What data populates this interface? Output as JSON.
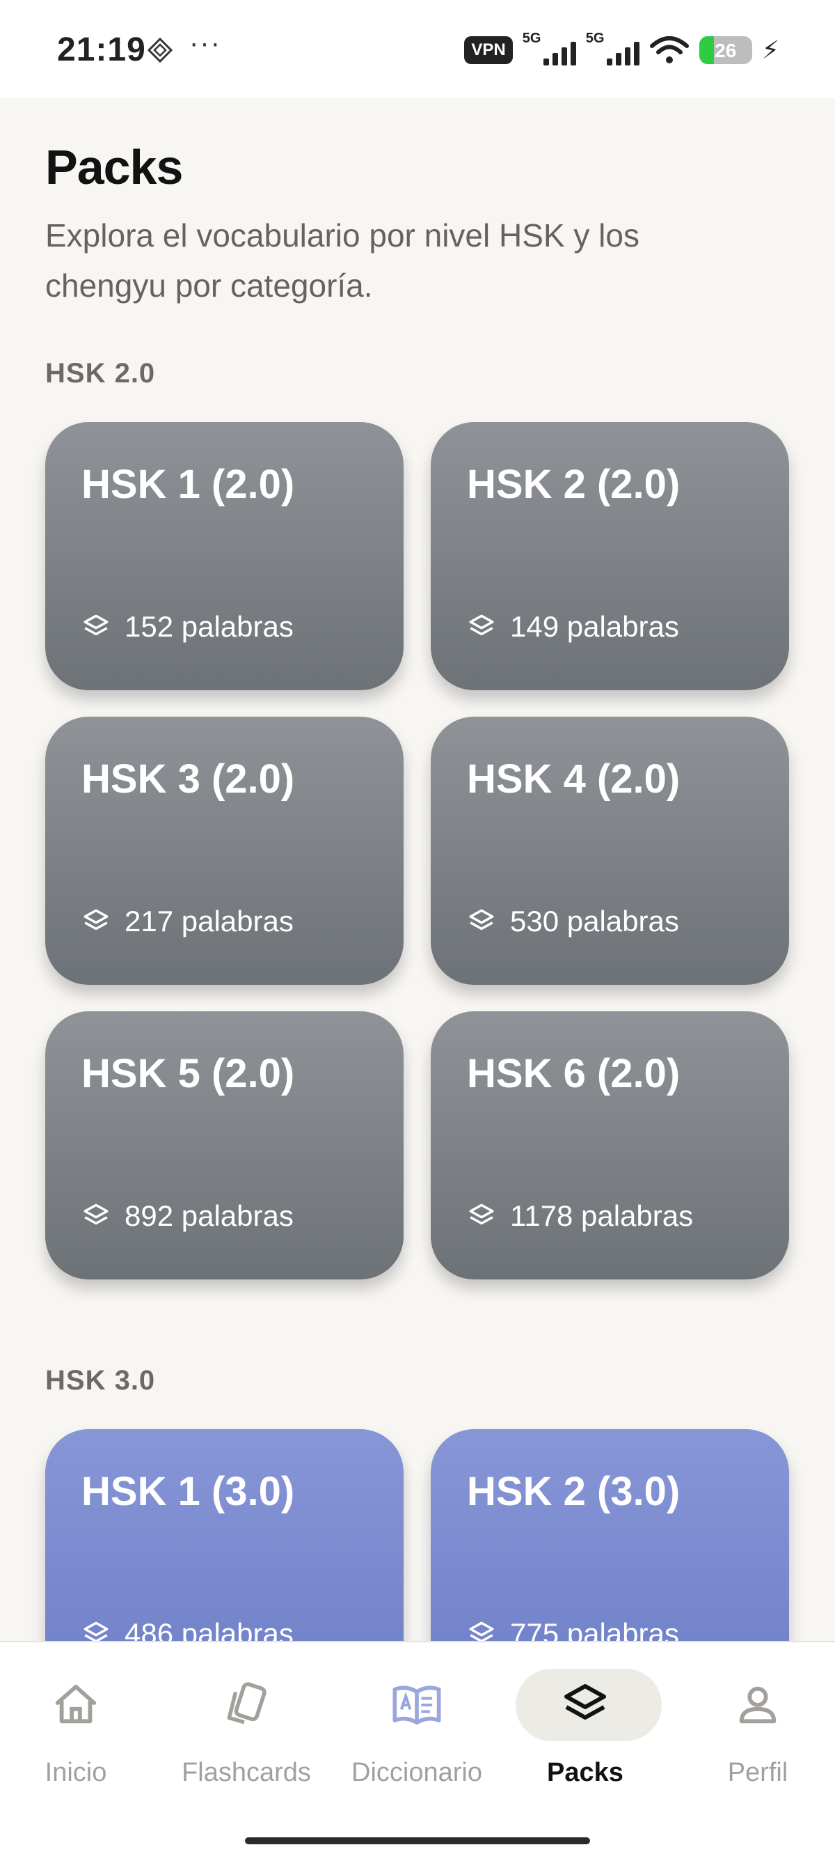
{
  "status_bar": {
    "time": "21:19",
    "vpn": "VPN",
    "network_1": "5G",
    "network_2": "5G",
    "battery": "26",
    "icons": [
      "location-diamond-icon",
      "more-dots-icon",
      "signal-icon",
      "wifi-icon",
      "battery-icon",
      "charging-bolt-icon"
    ]
  },
  "header": {
    "title": "Packs",
    "description": "Explora el vocabulario por nivel HSK y los chengyu por categoría."
  },
  "sections": [
    {
      "label": "HSK 2.0",
      "color": "#7d8186",
      "cards": [
        {
          "title": "HSK 1 (2.0)",
          "count": "152 palabras"
        },
        {
          "title": "HSK 2 (2.0)",
          "count": "149 palabras"
        },
        {
          "title": "HSK 3 (2.0)",
          "count": "217 palabras"
        },
        {
          "title": "HSK 4 (2.0)",
          "count": "530 palabras"
        },
        {
          "title": "HSK 5 (2.0)",
          "count": "892 palabras"
        },
        {
          "title": "HSK 6 (2.0)",
          "count": "1178 palabras"
        }
      ]
    },
    {
      "label": "HSK 3.0",
      "color": "#7a8acf",
      "cards": [
        {
          "title": "HSK 1 (3.0)",
          "count": "486 palabras"
        },
        {
          "title": "HSK 2 (3.0)",
          "count": "775 palabras"
        }
      ]
    }
  ],
  "bottom_nav": {
    "items": [
      {
        "label": "Inicio",
        "icon": "home-icon",
        "active": false
      },
      {
        "label": "Flashcards",
        "icon": "cards-icon",
        "active": false
      },
      {
        "label": "Diccionario",
        "icon": "dictionary-book-icon",
        "active": false
      },
      {
        "label": "Packs",
        "icon": "layers-icon",
        "active": true
      },
      {
        "label": "Perfil",
        "icon": "person-icon",
        "active": false
      }
    ]
  }
}
